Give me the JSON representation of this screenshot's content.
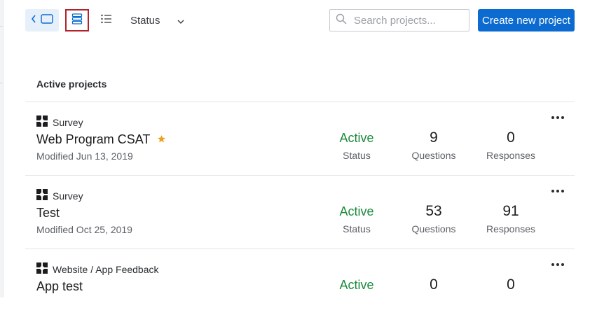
{
  "toolbar": {
    "status_filter_label": "Status",
    "search_placeholder": "Search projects...",
    "create_button_label": "Create new project"
  },
  "section": {
    "title": "Active projects"
  },
  "projects": [
    {
      "type": "Survey",
      "name": "Web Program CSAT",
      "starred": true,
      "modified": "Modified Jun 13, 2019",
      "status_value": "Active",
      "status_label": "Status",
      "questions_value": "9",
      "questions_label": "Questions",
      "responses_value": "0",
      "responses_label": "Responses"
    },
    {
      "type": "Survey",
      "name": "Test",
      "starred": false,
      "modified": "Modified Oct 25, 2019",
      "status_value": "Active",
      "status_label": "Status",
      "questions_value": "53",
      "questions_label": "Questions",
      "responses_value": "91",
      "responses_label": "Responses"
    },
    {
      "type": "Website / App Feedback",
      "name": "App test",
      "starred": false,
      "modified": "",
      "status_value": "Active",
      "status_label": "",
      "questions_value": "0",
      "questions_label": "",
      "responses_value": "0",
      "responses_label": ""
    }
  ],
  "colors": {
    "accent": "#0b6bd0",
    "active_status": "#1a8a3c",
    "star": "#f0a020",
    "selected_outline": "#b3222c"
  }
}
